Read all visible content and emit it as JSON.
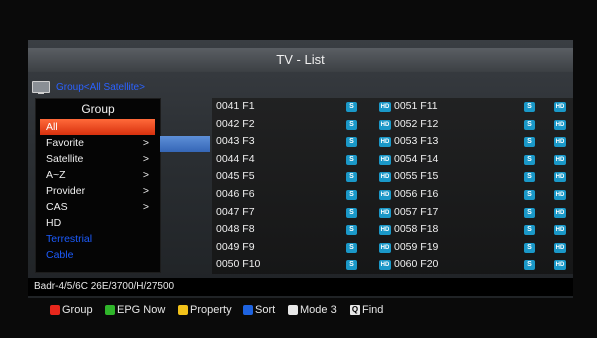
{
  "window": {
    "title": "TV - List"
  },
  "group_header": "Group<All Satellite>",
  "group_panel": {
    "title": "Group",
    "items": [
      {
        "label": "All",
        "arrow": ""
      },
      {
        "label": "Favorite",
        "arrow": ">"
      },
      {
        "label": "Satellite",
        "arrow": ">"
      },
      {
        "label": "A~Z",
        "arrow": ">"
      },
      {
        "label": "Provider",
        "arrow": ">"
      },
      {
        "label": "CAS",
        "arrow": ">"
      },
      {
        "label": "HD",
        "arrow": ""
      },
      {
        "label": "Terrestrial",
        "arrow": ""
      },
      {
        "label": "Cable",
        "arrow": ""
      }
    ]
  },
  "badges": {
    "s": "S",
    "hd": "HD"
  },
  "channels_left": [
    "0041 F1",
    "0042 F2",
    "0043 F3",
    "0044 F4",
    "0045 F5",
    "0046 F6",
    "0047 F7",
    "0048 F8",
    "0049 F9",
    "0050 F10"
  ],
  "channels_right": [
    "0051 F11",
    "0052 F12",
    "0053 F13",
    "0054 F14",
    "0055 F15",
    "0056 F16",
    "0057 F17",
    "0058 F18",
    "0059 F19",
    "0060 F20"
  ],
  "info_bar": "Badr-4/5/6C 26E/3700/H/27500",
  "footer": {
    "group": "Group",
    "epg": "EPG Now",
    "property": "Property",
    "sort": "Sort",
    "mode": "Mode 3",
    "find": "Find",
    "find_icon_glyph": "Q"
  },
  "colors": {
    "red_key": "#e8271c",
    "green_key": "#2fb52a",
    "yellow_key": "#f2c21a",
    "blue_key": "#1e63e0",
    "white_key": "#e8e8e8",
    "selected": "#e0401a",
    "badge": "#1a98c8",
    "header_text": "#2b62ff"
  }
}
